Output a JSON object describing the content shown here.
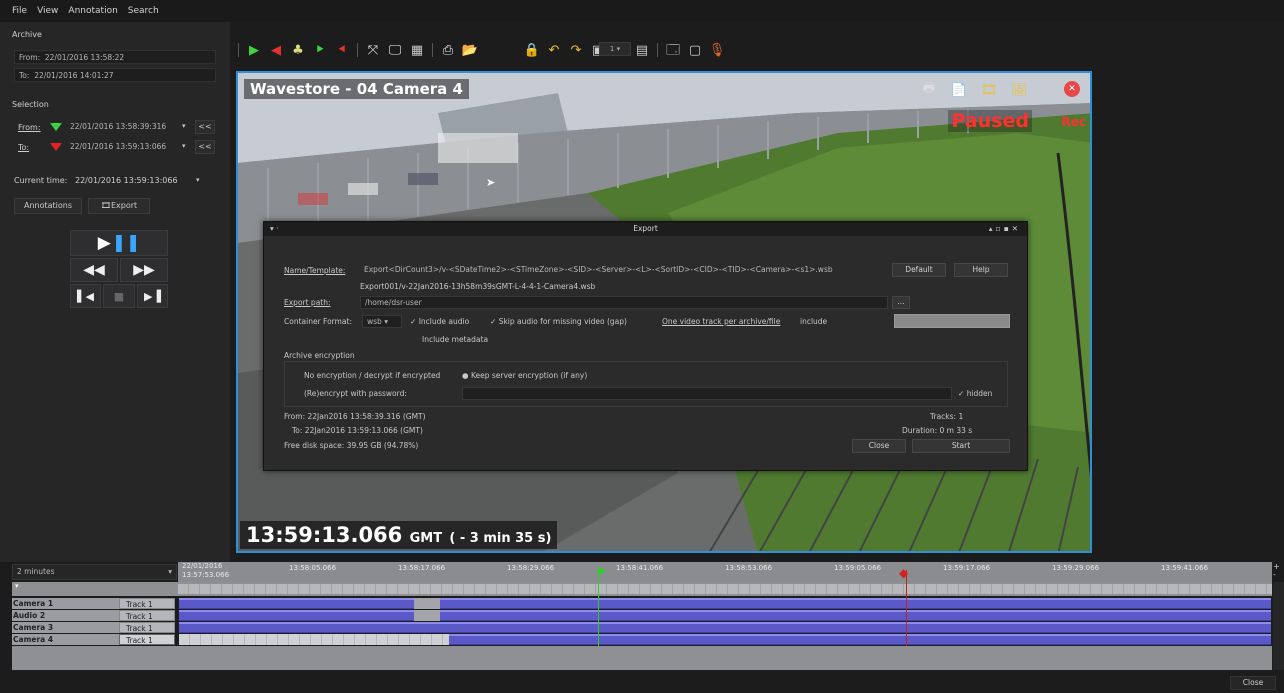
{
  "menubar": {
    "file": "File",
    "view": "View",
    "annotation": "Annotation",
    "search": "Search"
  },
  "archive": {
    "heading": "Archive",
    "from_label": "From:",
    "from_value": "22/01/2016 13:58:22",
    "to_label": "To:",
    "to_value": "22/01/2016 14:01:27"
  },
  "selection": {
    "heading": "Selection",
    "from_label": "From:",
    "from_value": "22/01/2016 13:58:39:316",
    "to_label": "To:",
    "to_value": "22/01/2016 13:59:13:066",
    "rewind": "<<"
  },
  "current_time": {
    "label": "Current time:",
    "value": "22/01/2016 13:59:13:066"
  },
  "left_buttons": {
    "annotations": "Annotations",
    "export": "Export"
  },
  "video": {
    "title": "Wavestore - 04 Camera 4",
    "status": "Paused",
    "rec": "Rec",
    "timestamp": "13:59:13.066",
    "tz": "GMT",
    "offset": "( - 3 min 35 s)"
  },
  "toolbar": {
    "channel_value": "1"
  },
  "export_dialog": {
    "title": "Export",
    "name_label": "Name/Template:",
    "name_value": "Export<DirCount3>/v-<SDateTime2>-<STimeZone>-<SID>-<Server>-<L>-<SortID>-<CID>-<TID>-<Camera>-<s1>.wsb",
    "default_btn": "Default",
    "help_btn": "Help",
    "name_preview": "Export001/v-22Jan2016-13h58m39sGMT-L-4-4-1-Camera4.wsb",
    "path_label": "Export path:",
    "path_value": "/home/dsr-user",
    "browse_btn": "...",
    "format_label": "Container Format:",
    "format_value": "wsb",
    "include_audio": "Include audio",
    "skip_audio": "Skip audio for missing video (gap)",
    "one_track": "One video track per archive/file",
    "include": "include",
    "include_metadata": "Include metadata",
    "encryption_heading": "Archive encryption",
    "no_encryption": "No encryption / decrypt if encrypted",
    "keep_encryption": "Keep server encryption (if any)",
    "reencrypt": "(Re)encrypt with password:",
    "hidden": "hidden",
    "from_line": "From: 22Jan2016 13:58:39.316 (GMT)",
    "to_line": "To: 22Jan2016 13:59:13.066 (GMT)",
    "tracks": "Tracks: 1",
    "duration": "Duration: 0 m 33 s",
    "disk": "Free disk space: 39.95 GB (94.78%)",
    "close_btn": "Close",
    "start_btn": "Start"
  },
  "timeline": {
    "zoom": "2 minutes",
    "first_date": "22/01/2016",
    "first_time": "13:57:53.066",
    "ticks": [
      "13:58:05.066",
      "13:58:17.066",
      "13:58:29.066",
      "13:58:41.066",
      "13:58:53.066",
      "13:59:05.066",
      "13:59:17.066",
      "13:59:29.066",
      "13:59:41.066"
    ],
    "tracks": [
      {
        "camera": "Camera 1",
        "track": "Track 1"
      },
      {
        "camera": "Audio 2",
        "track": "Track 1"
      },
      {
        "camera": "Camera 3",
        "track": "Track 1"
      },
      {
        "camera": "Camera 4",
        "track": "Track 1"
      }
    ],
    "close": "Close"
  }
}
